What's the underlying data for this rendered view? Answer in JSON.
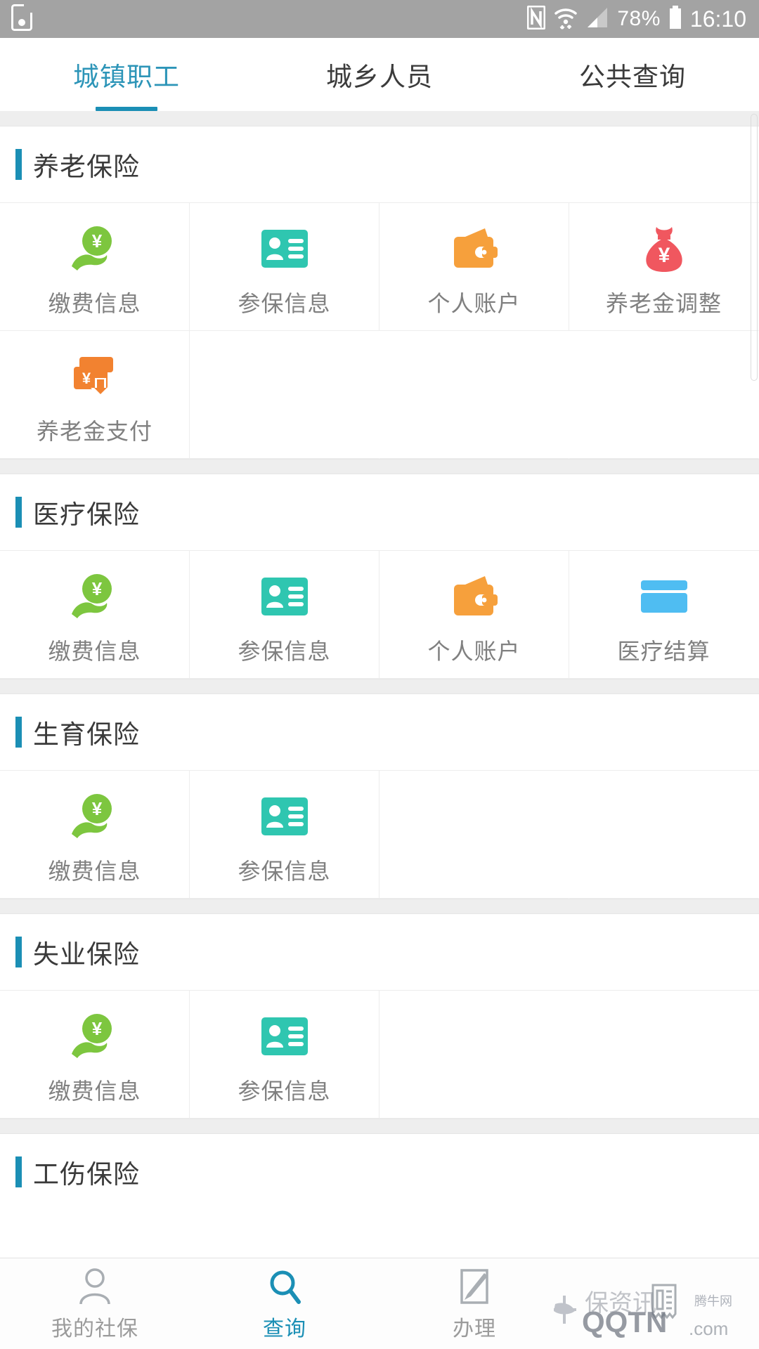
{
  "statusbar": {
    "left_icon": "screen-record-icon",
    "nfc_icon": "nfc-icon",
    "wifi_icon": "wifi-icon",
    "signal_icon": "signal-bars-icon",
    "battery_percent": "78%",
    "battery_icon": "battery-icon",
    "clock": "16:10"
  },
  "tabs": [
    {
      "label": "城镇职工",
      "active": true
    },
    {
      "label": "城乡人员",
      "active": false
    },
    {
      "label": "公共查询",
      "active": false
    }
  ],
  "colors": {
    "accent": "#1b8fb5",
    "tab_active_text": "#2d95b8",
    "green": "#7dc63f",
    "teal": "#2fc6b0",
    "orange": "#f6a03c",
    "red": "#f0575f",
    "blue": "#4fbdf2",
    "deep_orange": "#f28230",
    "band": "#eeeeee",
    "label_gray": "#808080"
  },
  "sections": [
    {
      "title": "养老保险",
      "items": [
        {
          "label": "缴费信息",
          "icon": "hand-yen-icon"
        },
        {
          "label": "参保信息",
          "icon": "id-card-icon"
        },
        {
          "label": "个人账户",
          "icon": "wallet-icon"
        },
        {
          "label": "养老金调整",
          "icon": "money-bag-icon"
        },
        {
          "label": "养老金支付",
          "icon": "card-payout-icon"
        }
      ]
    },
    {
      "title": "医疗保险",
      "items": [
        {
          "label": "缴费信息",
          "icon": "hand-yen-icon"
        },
        {
          "label": "参保信息",
          "icon": "id-card-icon"
        },
        {
          "label": "个人账户",
          "icon": "wallet-icon"
        },
        {
          "label": "医疗结算",
          "icon": "bank-card-icon"
        }
      ]
    },
    {
      "title": "生育保险",
      "items": [
        {
          "label": "缴费信息",
          "icon": "hand-yen-icon"
        },
        {
          "label": "参保信息",
          "icon": "id-card-icon"
        }
      ]
    },
    {
      "title": "失业保险",
      "items": [
        {
          "label": "缴费信息",
          "icon": "hand-yen-icon"
        },
        {
          "label": "参保信息",
          "icon": "id-card-icon"
        }
      ]
    },
    {
      "title": "工伤保险",
      "items": []
    }
  ],
  "bottom_nav": [
    {
      "label": "我的社保",
      "icon": "person-icon",
      "active": false
    },
    {
      "label": "查询",
      "icon": "search-icon",
      "active": true
    },
    {
      "label": "办理",
      "icon": "pencil-note-icon",
      "active": false
    },
    {
      "label": "",
      "icon": "receipt-icon",
      "active": false
    }
  ],
  "watermark": {
    "main": "QQTN.com",
    "sub": "腾牛网"
  }
}
